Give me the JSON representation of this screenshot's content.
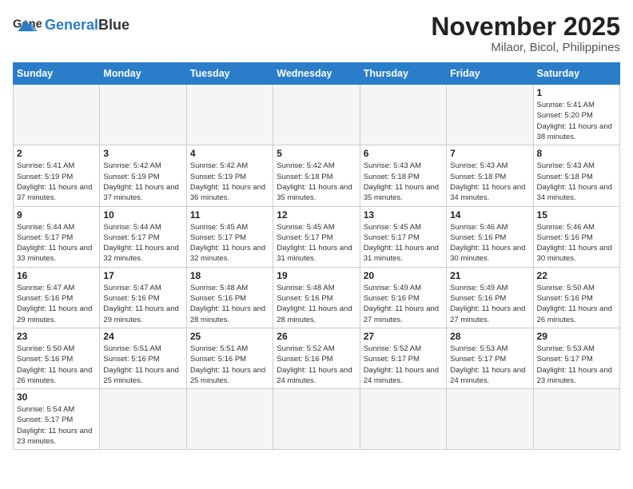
{
  "header": {
    "logo_general": "General",
    "logo_blue": "Blue",
    "title": "November 2025",
    "subtitle": "Milaor, Bicol, Philippines"
  },
  "weekdays": [
    "Sunday",
    "Monday",
    "Tuesday",
    "Wednesday",
    "Thursday",
    "Friday",
    "Saturday"
  ],
  "weeks": [
    [
      {
        "day": "",
        "empty": true
      },
      {
        "day": "",
        "empty": true
      },
      {
        "day": "",
        "empty": true
      },
      {
        "day": "",
        "empty": true
      },
      {
        "day": "",
        "empty": true
      },
      {
        "day": "",
        "empty": true
      },
      {
        "day": "1",
        "sunrise": "5:41 AM",
        "sunset": "5:20 PM",
        "daylight": "11 hours and 38 minutes."
      }
    ],
    [
      {
        "day": "2",
        "sunrise": "5:41 AM",
        "sunset": "5:19 PM",
        "daylight": "11 hours and 37 minutes."
      },
      {
        "day": "3",
        "sunrise": "5:42 AM",
        "sunset": "5:19 PM",
        "daylight": "11 hours and 37 minutes."
      },
      {
        "day": "4",
        "sunrise": "5:42 AM",
        "sunset": "5:19 PM",
        "daylight": "11 hours and 36 minutes."
      },
      {
        "day": "5",
        "sunrise": "5:42 AM",
        "sunset": "5:18 PM",
        "daylight": "11 hours and 35 minutes."
      },
      {
        "day": "6",
        "sunrise": "5:43 AM",
        "sunset": "5:18 PM",
        "daylight": "11 hours and 35 minutes."
      },
      {
        "day": "7",
        "sunrise": "5:43 AM",
        "sunset": "5:18 PM",
        "daylight": "11 hours and 34 minutes."
      },
      {
        "day": "8",
        "sunrise": "5:43 AM",
        "sunset": "5:18 PM",
        "daylight": "11 hours and 34 minutes."
      }
    ],
    [
      {
        "day": "9",
        "sunrise": "5:44 AM",
        "sunset": "5:17 PM",
        "daylight": "11 hours and 33 minutes."
      },
      {
        "day": "10",
        "sunrise": "5:44 AM",
        "sunset": "5:17 PM",
        "daylight": "11 hours and 32 minutes."
      },
      {
        "day": "11",
        "sunrise": "5:45 AM",
        "sunset": "5:17 PM",
        "daylight": "11 hours and 32 minutes."
      },
      {
        "day": "12",
        "sunrise": "5:45 AM",
        "sunset": "5:17 PM",
        "daylight": "11 hours and 31 minutes."
      },
      {
        "day": "13",
        "sunrise": "5:45 AM",
        "sunset": "5:17 PM",
        "daylight": "11 hours and 31 minutes."
      },
      {
        "day": "14",
        "sunrise": "5:46 AM",
        "sunset": "5:16 PM",
        "daylight": "11 hours and 30 minutes."
      },
      {
        "day": "15",
        "sunrise": "5:46 AM",
        "sunset": "5:16 PM",
        "daylight": "11 hours and 30 minutes."
      }
    ],
    [
      {
        "day": "16",
        "sunrise": "5:47 AM",
        "sunset": "5:16 PM",
        "daylight": "11 hours and 29 minutes."
      },
      {
        "day": "17",
        "sunrise": "5:47 AM",
        "sunset": "5:16 PM",
        "daylight": "11 hours and 29 minutes."
      },
      {
        "day": "18",
        "sunrise": "5:48 AM",
        "sunset": "5:16 PM",
        "daylight": "11 hours and 28 minutes."
      },
      {
        "day": "19",
        "sunrise": "5:48 AM",
        "sunset": "5:16 PM",
        "daylight": "11 hours and 28 minutes."
      },
      {
        "day": "20",
        "sunrise": "5:49 AM",
        "sunset": "5:16 PM",
        "daylight": "11 hours and 27 minutes."
      },
      {
        "day": "21",
        "sunrise": "5:49 AM",
        "sunset": "5:16 PM",
        "daylight": "11 hours and 27 minutes."
      },
      {
        "day": "22",
        "sunrise": "5:50 AM",
        "sunset": "5:16 PM",
        "daylight": "11 hours and 26 minutes."
      }
    ],
    [
      {
        "day": "23",
        "sunrise": "5:50 AM",
        "sunset": "5:16 PM",
        "daylight": "11 hours and 26 minutes."
      },
      {
        "day": "24",
        "sunrise": "5:51 AM",
        "sunset": "5:16 PM",
        "daylight": "11 hours and 25 minutes."
      },
      {
        "day": "25",
        "sunrise": "5:51 AM",
        "sunset": "5:16 PM",
        "daylight": "11 hours and 25 minutes."
      },
      {
        "day": "26",
        "sunrise": "5:52 AM",
        "sunset": "5:16 PM",
        "daylight": "11 hours and 24 minutes."
      },
      {
        "day": "27",
        "sunrise": "5:52 AM",
        "sunset": "5:17 PM",
        "daylight": "11 hours and 24 minutes."
      },
      {
        "day": "28",
        "sunrise": "5:53 AM",
        "sunset": "5:17 PM",
        "daylight": "11 hours and 24 minutes."
      },
      {
        "day": "29",
        "sunrise": "5:53 AM",
        "sunset": "5:17 PM",
        "daylight": "11 hours and 23 minutes."
      }
    ],
    [
      {
        "day": "30",
        "sunrise": "5:54 AM",
        "sunset": "5:17 PM",
        "daylight": "11 hours and 23 minutes."
      },
      {
        "day": "",
        "empty": true
      },
      {
        "day": "",
        "empty": true
      },
      {
        "day": "",
        "empty": true
      },
      {
        "day": "",
        "empty": true
      },
      {
        "day": "",
        "empty": true
      },
      {
        "day": "",
        "empty": true
      }
    ]
  ]
}
